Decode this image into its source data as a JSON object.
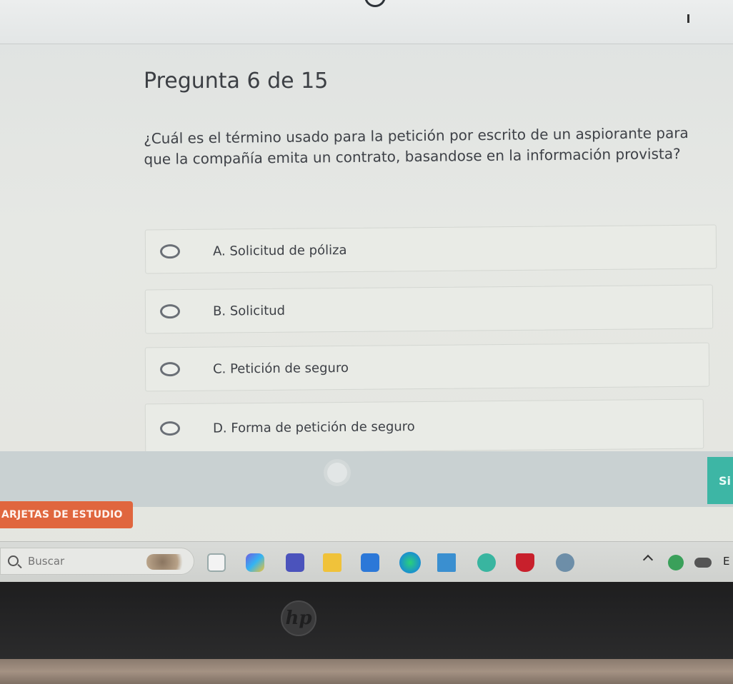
{
  "question": {
    "title": "Pregunta 6 de 15",
    "text": "¿Cuál es el término usado para la petición por escrito de un aspiorante para que la compañía emita un contrato, basandose en la información provista?"
  },
  "options": [
    {
      "label": "A. Solicitud de póliza",
      "selected": false
    },
    {
      "label": "B. Solicitud",
      "selected": false
    },
    {
      "label": "C. Petición de seguro",
      "selected": false
    },
    {
      "label": "D. Forma de petición de seguro",
      "selected": false
    }
  ],
  "footer": {
    "next_label": "Si",
    "study_cards_label": "ARJETAS DE ESTUDIO"
  },
  "taskbar": {
    "search_placeholder": "Buscar",
    "icons": [
      "file-explorer-icon",
      "copilot-icon",
      "teams-icon",
      "folder-icon",
      "store-icon",
      "edge-icon",
      "mcgraw-hill-icon",
      "help-icon",
      "mcafee-icon",
      "settings-icon"
    ],
    "tray_label": "E"
  },
  "colors": {
    "next_button": "#3db6a5",
    "study_cards": "#e0663e",
    "footer_bar": "#c9d1d2"
  },
  "device": {
    "logo": "hp"
  }
}
